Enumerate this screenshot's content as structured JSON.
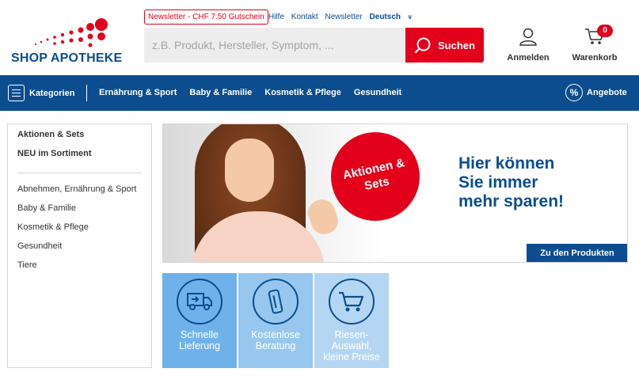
{
  "header": {
    "logo_text": "SHOP APOTHEKE",
    "newsletter_badge": "Newsletter - CHF 7.50 Gutschein",
    "top_links": [
      "Hilfe",
      "Kontakt",
      "Newsletter"
    ],
    "language": "Deutsch",
    "search_placeholder": "z.B. Produkt, Hersteller, Symptom, ...",
    "search_button": "Suchen",
    "account_label": "Anmelden",
    "cart_label": "Warenkorb",
    "cart_count": "0"
  },
  "nav": {
    "categories_label": "Kategorien",
    "items": [
      "Ernährung & Sport",
      "Baby & Familie",
      "Kosmetik & Pflege",
      "Gesundheit"
    ],
    "offers_label": "Angebote"
  },
  "sidebar": {
    "highlights": [
      "Aktionen & Sets",
      "NEU im Sortiment"
    ],
    "categories": [
      "Abnehmen, Ernährung & Sport",
      "Baby & Familie",
      "Kosmetik & Pflege",
      "Gesundheit",
      "Tiere"
    ]
  },
  "banner": {
    "badge": "Aktionen &\nSets",
    "headline": "Hier können\nSie immer\nmehr sparen!",
    "cta": "Zu den Produkten"
  },
  "tiles": [
    {
      "label": "Schnelle\nLieferung",
      "icon": "delivery-truck-icon"
    },
    {
      "label": "Kostenlose\nBeratung",
      "icon": "phone-icon"
    },
    {
      "label": "Riesen-\nAuswahl,\nkleine Preise",
      "icon": "shopping-cart-icon"
    }
  ],
  "colors": {
    "brand_blue": "#0b4d8f",
    "brand_red": "#e3001b"
  }
}
